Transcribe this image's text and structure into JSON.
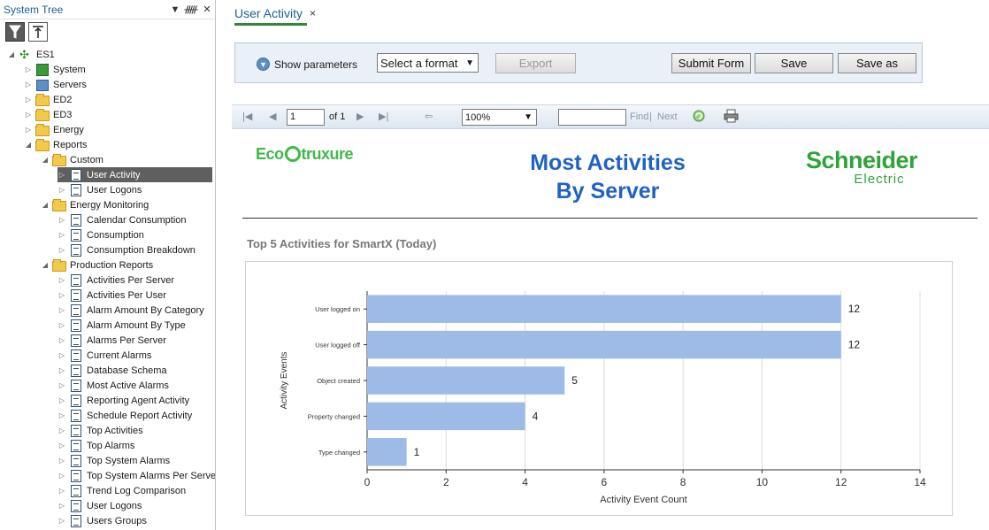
{
  "panel": {
    "title": "System Tree",
    "header_icons": [
      "chevron-down-icon",
      "pin-icon",
      "close-icon"
    ],
    "tools": [
      "filter-icon",
      "navigate-up-icon"
    ]
  },
  "tree": [
    {
      "label": "ES1",
      "depth": 0,
      "icon": "network-icon",
      "expander": "expanded"
    },
    {
      "label": "System",
      "depth": 1,
      "icon": "system-icon",
      "expander": "collapsed"
    },
    {
      "label": "Servers",
      "depth": 1,
      "icon": "server-icon",
      "expander": "collapsed"
    },
    {
      "label": "ED2",
      "depth": 1,
      "icon": "folder-icon",
      "expander": "collapsed"
    },
    {
      "label": "ED3",
      "depth": 1,
      "icon": "folder-icon",
      "expander": "collapsed"
    },
    {
      "label": "Energy",
      "depth": 1,
      "icon": "folder-icon",
      "expander": "collapsed"
    },
    {
      "label": "Reports",
      "depth": 1,
      "icon": "folder-icon",
      "expander": "expanded"
    },
    {
      "label": "Custom",
      "depth": 2,
      "icon": "folder-icon",
      "expander": "expanded"
    },
    {
      "label": "User Activity",
      "depth": 3,
      "icon": "report-icon",
      "expander": "collapsed",
      "selected": true
    },
    {
      "label": "User Logons",
      "depth": 3,
      "icon": "report-icon",
      "expander": "collapsed"
    },
    {
      "label": "Energy Monitoring",
      "depth": 2,
      "icon": "folder-icon",
      "expander": "expanded"
    },
    {
      "label": "Calendar Consumption",
      "depth": 3,
      "icon": "report-icon",
      "expander": "collapsed"
    },
    {
      "label": "Consumption",
      "depth": 3,
      "icon": "report-icon",
      "expander": "collapsed"
    },
    {
      "label": "Consumption Breakdown",
      "depth": 3,
      "icon": "report-icon",
      "expander": "collapsed"
    },
    {
      "label": "Production Reports",
      "depth": 2,
      "icon": "folder-icon",
      "expander": "expanded"
    },
    {
      "label": "Activities Per Server",
      "depth": 3,
      "icon": "report-icon",
      "expander": "collapsed"
    },
    {
      "label": "Activities Per User",
      "depth": 3,
      "icon": "report-icon",
      "expander": "collapsed"
    },
    {
      "label": "Alarm Amount By Category",
      "depth": 3,
      "icon": "report-icon",
      "expander": "collapsed"
    },
    {
      "label": "Alarm Amount By Type",
      "depth": 3,
      "icon": "report-icon",
      "expander": "collapsed"
    },
    {
      "label": "Alarms Per Server",
      "depth": 3,
      "icon": "report-icon",
      "expander": "collapsed"
    },
    {
      "label": "Current Alarms",
      "depth": 3,
      "icon": "report-icon",
      "expander": "collapsed"
    },
    {
      "label": "Database Schema",
      "depth": 3,
      "icon": "report-icon",
      "expander": "collapsed"
    },
    {
      "label": "Most Active Alarms",
      "depth": 3,
      "icon": "report-icon",
      "expander": "collapsed"
    },
    {
      "label": "Reporting Agent Activity",
      "depth": 3,
      "icon": "report-icon",
      "expander": "collapsed"
    },
    {
      "label": "Schedule Report Activity",
      "depth": 3,
      "icon": "report-icon",
      "expander": "collapsed"
    },
    {
      "label": "Top Activities",
      "depth": 3,
      "icon": "report-icon",
      "expander": "collapsed"
    },
    {
      "label": "Top Alarms",
      "depth": 3,
      "icon": "report-icon",
      "expander": "collapsed"
    },
    {
      "label": "Top System Alarms",
      "depth": 3,
      "icon": "report-icon",
      "expander": "collapsed"
    },
    {
      "label": "Top System Alarms Per Serve",
      "depth": 3,
      "icon": "report-icon",
      "expander": "collapsed"
    },
    {
      "label": "Trend Log Comparison",
      "depth": 3,
      "icon": "report-icon",
      "expander": "collapsed"
    },
    {
      "label": "User Logons",
      "depth": 3,
      "icon": "report-icon",
      "expander": "collapsed"
    },
    {
      "label": "Users Groups",
      "depth": 3,
      "icon": "report-icon",
      "expander": "collapsed"
    }
  ],
  "tab": {
    "label": "User Activity",
    "close": "×",
    "accent": "#2f8a3a"
  },
  "params": {
    "show_label": "Show parameters",
    "format_value": "Select a format",
    "export_label": "Export",
    "submit_label": "Submit Form",
    "save_label": "Save",
    "saveas_label": "Save as"
  },
  "toolbar": {
    "page_value": "1",
    "of_label": "of 1",
    "zoom_value": "100%",
    "find_value": "",
    "find_label": "Find",
    "separator": "|",
    "next_label": "Next"
  },
  "report": {
    "logo_left_a": "Eco",
    "logo_left_b": "truxure",
    "title_line1": "Most Activities",
    "title_line2": "By Server",
    "logo_right_line1": "Schneider",
    "logo_right_line2": "Electric",
    "chart_heading": "Top 5 Activities for SmartX (Today)",
    "brand_green": "#3dba4a",
    "title_blue": "#1f63c2"
  },
  "chart_data": {
    "type": "bar",
    "orientation": "horizontal",
    "categories": [
      "User logged on",
      "User logged off",
      "Object created",
      "Property changed",
      "Type changed"
    ],
    "values": [
      12,
      12,
      5,
      4,
      1
    ],
    "xlabel": "Activity Event Count",
    "ylabel": "Activity Events",
    "xlim": [
      0,
      14
    ],
    "xticks": [
      0,
      2,
      4,
      6,
      8,
      10,
      12,
      14
    ],
    "grid": true,
    "bar_color": "#9dbbe6",
    "data_labels": true
  }
}
